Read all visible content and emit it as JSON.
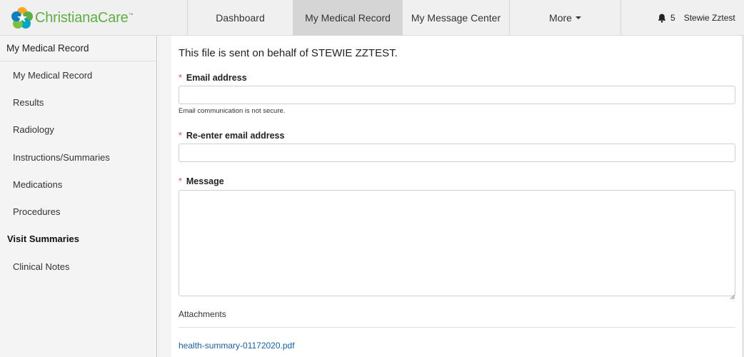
{
  "brand": {
    "name": "ChristianaCare",
    "mark": "™",
    "color": "#5fae43"
  },
  "nav": {
    "tabs": [
      {
        "label": "Dashboard",
        "active": false
      },
      {
        "label": "My Medical Record",
        "active": true
      },
      {
        "label": "My Message Center",
        "active": false
      },
      {
        "label": "More",
        "active": false,
        "has_caret": true
      }
    ],
    "notifications": {
      "icon": "bell-icon",
      "count": "5"
    },
    "user": "Stewie Zztest"
  },
  "sidebar": {
    "header": "My Medical Record",
    "items": [
      {
        "label": "My Medical Record",
        "bold": false
      },
      {
        "label": "Results",
        "bold": false
      },
      {
        "label": "Radiology",
        "bold": false
      },
      {
        "label": "Instructions/Summaries",
        "bold": false
      },
      {
        "label": "Medications",
        "bold": false
      },
      {
        "label": "Procedures",
        "bold": false
      },
      {
        "label": "Visit Summaries",
        "bold": true
      },
      {
        "label": "Clinical Notes",
        "bold": false
      }
    ]
  },
  "form": {
    "intro": "This file is sent on behalf of STEWIE ZZTEST.",
    "required_mark": "*",
    "email_label": "Email address",
    "email_value": "",
    "email_hint": "Email communication is not secure.",
    "reenter_label": "Re-enter email address",
    "reenter_value": "",
    "message_label": "Message",
    "message_value": "",
    "attachments_label": "Attachments",
    "attachment_file": "health-summary-01172020.pdf"
  }
}
